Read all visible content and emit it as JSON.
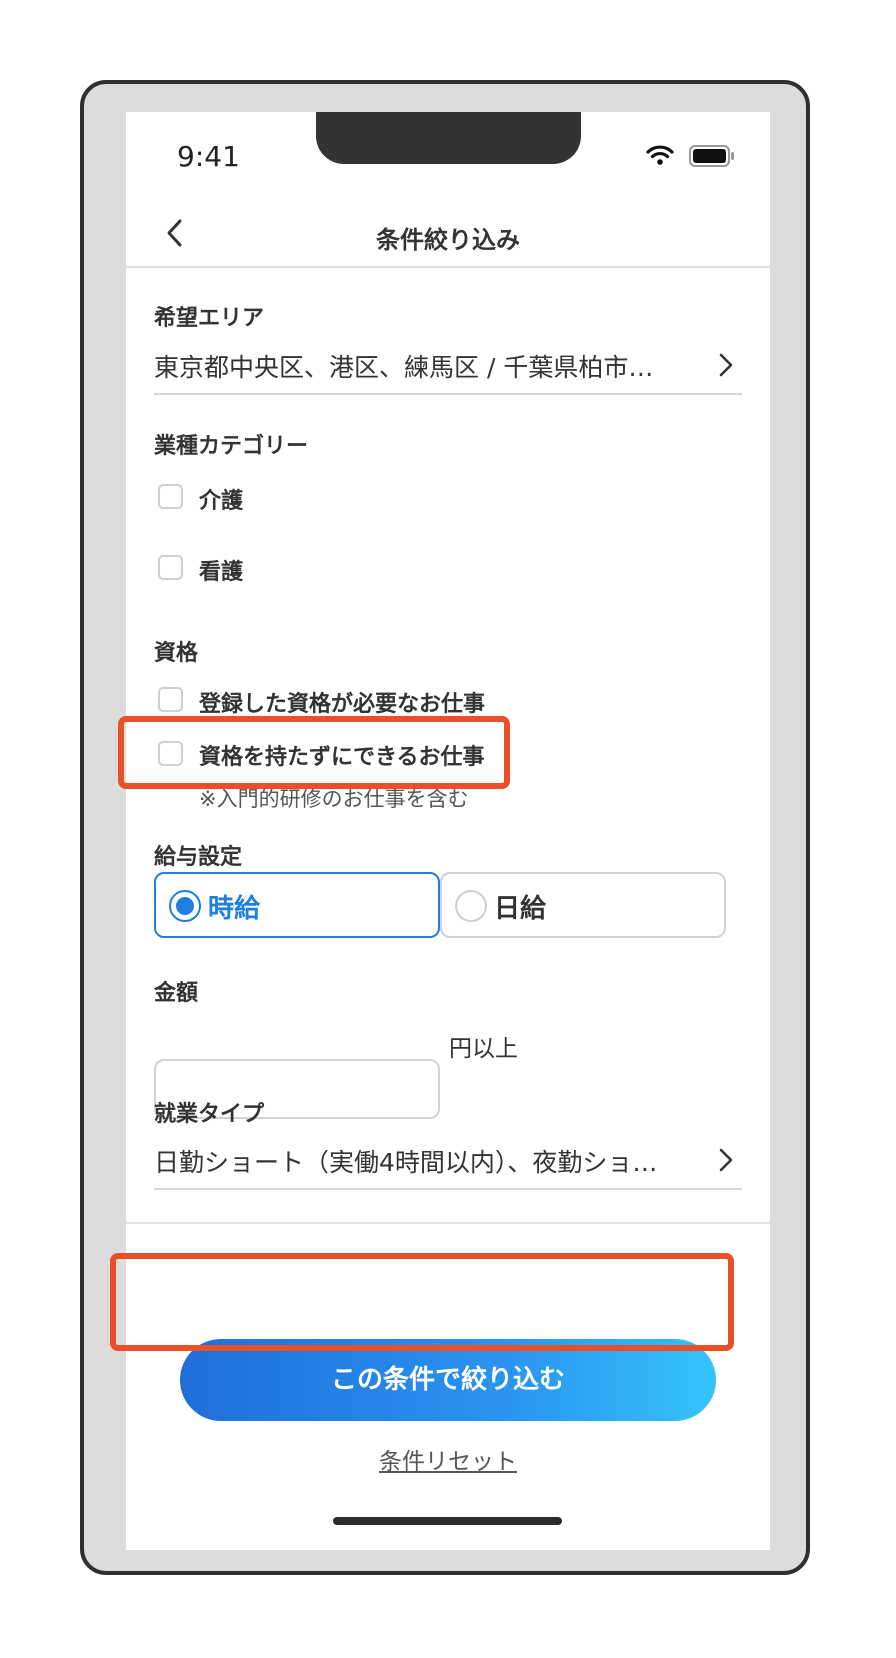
{
  "status_bar": {
    "time": "9:41"
  },
  "header": {
    "title": "条件絞り込み"
  },
  "area": {
    "label": "希望エリア",
    "value": "東京都中央区、港区、練馬区 / 千葉県柏市…"
  },
  "category": {
    "label": "業種カテゴリー",
    "options": [
      {
        "label": "介護",
        "checked": false
      },
      {
        "label": "看護",
        "checked": false
      }
    ]
  },
  "qualification": {
    "label": "資格",
    "options": [
      {
        "label": "登録した資格が必要なお仕事",
        "checked": false
      },
      {
        "label": "資格を持たずにできるお仕事",
        "checked": false
      }
    ],
    "note": "※入門的研修のお仕事を含む"
  },
  "salary": {
    "label": "給与設定",
    "options": [
      {
        "label": "時給",
        "selected": true
      },
      {
        "label": "日給",
        "selected": false
      }
    ]
  },
  "amount": {
    "label": "金額",
    "value": "",
    "unit": "円以上"
  },
  "work_type": {
    "label": "就業タイプ",
    "value": "日勤ショート（実働4時間以内）、夜勤ショ…"
  },
  "actions": {
    "submit_label": "この条件で絞り込む",
    "reset_label": "条件リセット"
  },
  "colors": {
    "accent": "#1e7fe0",
    "highlight": "#e8502a",
    "gradient_start": "#1f6fd8",
    "gradient_end": "#34c3fb"
  }
}
